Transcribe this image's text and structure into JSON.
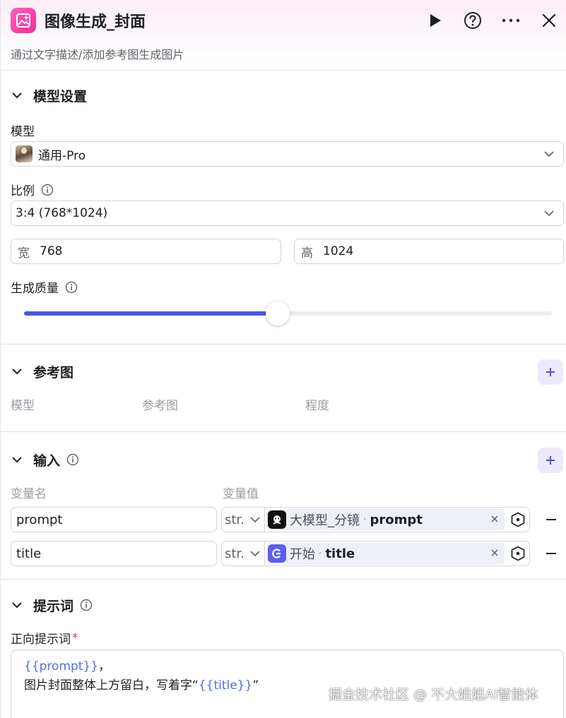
{
  "header": {
    "title": "图像生成_封面",
    "description": "通过文字描述/添加参考图生成图片",
    "icons": [
      "image-generate-icon",
      "play-icon",
      "help-icon",
      "more-icon",
      "close-icon"
    ]
  },
  "model_settings": {
    "section_title": "模型设置",
    "model_label": "模型",
    "model_value": "通用-Pro",
    "ratio_label": "比例",
    "ratio_value": "3:4 (768*1024)",
    "width_prefix": "宽",
    "width_value": "768",
    "height_prefix": "高",
    "height_value": "1024",
    "quality_label": "生成质量",
    "quality_level": 0.48
  },
  "reference": {
    "section_title": "参考图",
    "columns": [
      "模型",
      "参考图",
      "程度"
    ]
  },
  "inputs": {
    "section_title": "输入",
    "col_name": "变量名",
    "col_value": "变量值",
    "rows": [
      {
        "name": "prompt",
        "type": "str.",
        "ref_node": "大模型_分镜",
        "ref_var": "prompt"
      },
      {
        "name": "title",
        "type": "str.",
        "ref_node": "开始",
        "ref_var": "title"
      }
    ]
  },
  "prompt_section": {
    "section_title": "提示词",
    "positive_label": "正向提示词",
    "required_mark": "*",
    "line1_var": "{{prompt}}",
    "line1_suffix": "，",
    "line2_prefix": "图片封面整体上方留白，写着字“",
    "line2_var": "{{title}}",
    "line2_suffix": "”"
  },
  "watermark": "掘金技术社区 @ 不大姐姐AI智能体",
  "colors": {
    "accent": "#4d53e8",
    "app_icon": "#f02fa0",
    "template_var": "#4d6ef0",
    "required": "#e0333f"
  }
}
